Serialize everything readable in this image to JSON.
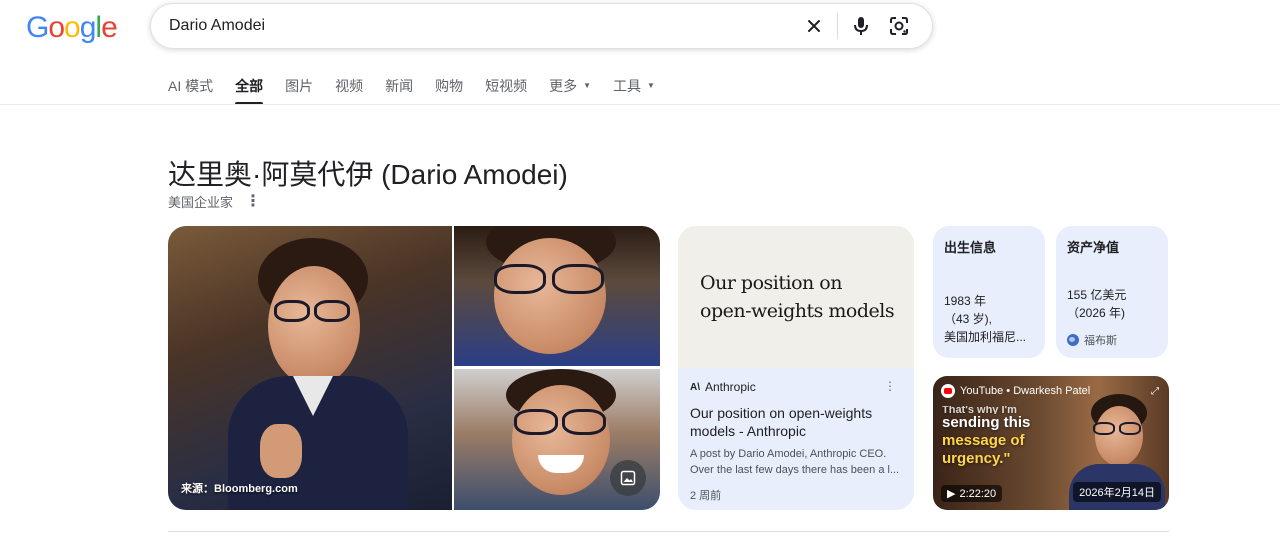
{
  "logo": {
    "letters": [
      "G",
      "o",
      "o",
      "g",
      "l",
      "e"
    ],
    "colors": [
      "#4285F4",
      "#EA4335",
      "#FBBC05",
      "#4285F4",
      "#34A853",
      "#EA4335"
    ]
  },
  "search": {
    "query": "Dario Amodei",
    "icons": [
      "close-icon",
      "mic-icon",
      "lens-icon"
    ]
  },
  "tabs": [
    {
      "label": "AI 模式"
    },
    {
      "label": "全部",
      "active": true
    },
    {
      "label": "图片"
    },
    {
      "label": "视频"
    },
    {
      "label": "新闻"
    },
    {
      "label": "购物"
    },
    {
      "label": "短视频"
    },
    {
      "label": "更多",
      "dropdown": true
    },
    {
      "label": "工具",
      "dropdown": true
    }
  ],
  "knowledge_panel": {
    "title": "达里奥·阿莫代伊 (Dario Amodei)",
    "subtitle": "美国企业家",
    "photo_source": "来源：Bloomberg.com"
  },
  "article": {
    "image_text_line1": "Our position on",
    "image_text_line2": "open-weights models",
    "source": "Anthropic",
    "source_logo": "A\\",
    "title": "Our position on open-weights models - Anthropic",
    "snippet_line1": "A post by Dario Amodei, Anthropic CEO.",
    "snippet_line2": "Over the last few days there has been a l...",
    "time": "2 周前"
  },
  "birth_card": {
    "heading": "出生信息",
    "line1": "1983 年",
    "line2": "（43 岁),",
    "line3": "美国加利福尼..."
  },
  "worth_card": {
    "heading": "资产净值",
    "line1": "155 亿美元",
    "line2": "（2026 年)",
    "source": "福布斯"
  },
  "video": {
    "channel": "YouTube • Dwarkesh Patel",
    "quote_line0": "That's why I'm",
    "quote_line1": "sending this",
    "quote_line2": "message of",
    "quote_line3": "urgency.\"",
    "duration": "2:22:20",
    "date": "2026年2月14日"
  }
}
